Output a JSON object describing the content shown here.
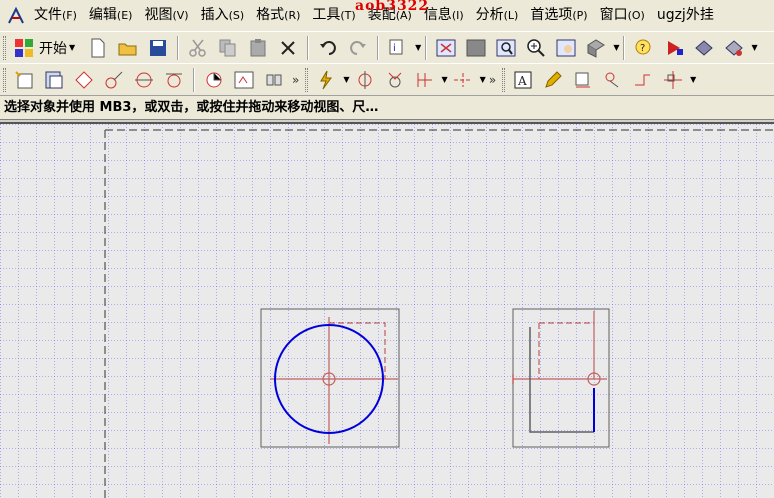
{
  "watermark": "aob3322",
  "menu": {
    "items": [
      {
        "label": "文件",
        "acc": "(F)"
      },
      {
        "label": "编辑",
        "acc": "(E)"
      },
      {
        "label": "视图",
        "acc": "(V)"
      },
      {
        "label": "插入",
        "acc": "(S)"
      },
      {
        "label": "格式",
        "acc": "(R)"
      },
      {
        "label": "工具",
        "acc": "(T)"
      },
      {
        "label": "装配",
        "acc": "(A)"
      },
      {
        "label": "信息",
        "acc": "(I)"
      },
      {
        "label": "分析",
        "acc": "(L)"
      },
      {
        "label": "首选项",
        "acc": "(P)"
      },
      {
        "label": "窗口",
        "acc": "(O)"
      },
      {
        "label": "ugzj外挂",
        "acc": ""
      }
    ]
  },
  "toolbar": {
    "start_label": "开始"
  },
  "status": {
    "prompt": "选择对象并使用 MB3，或双击，或按住并拖动来移动视图、尺…"
  },
  "colors": {
    "circle": "#0000dd",
    "centerline": "#c06060",
    "border": "#606060",
    "grid": "#3a3aff"
  }
}
